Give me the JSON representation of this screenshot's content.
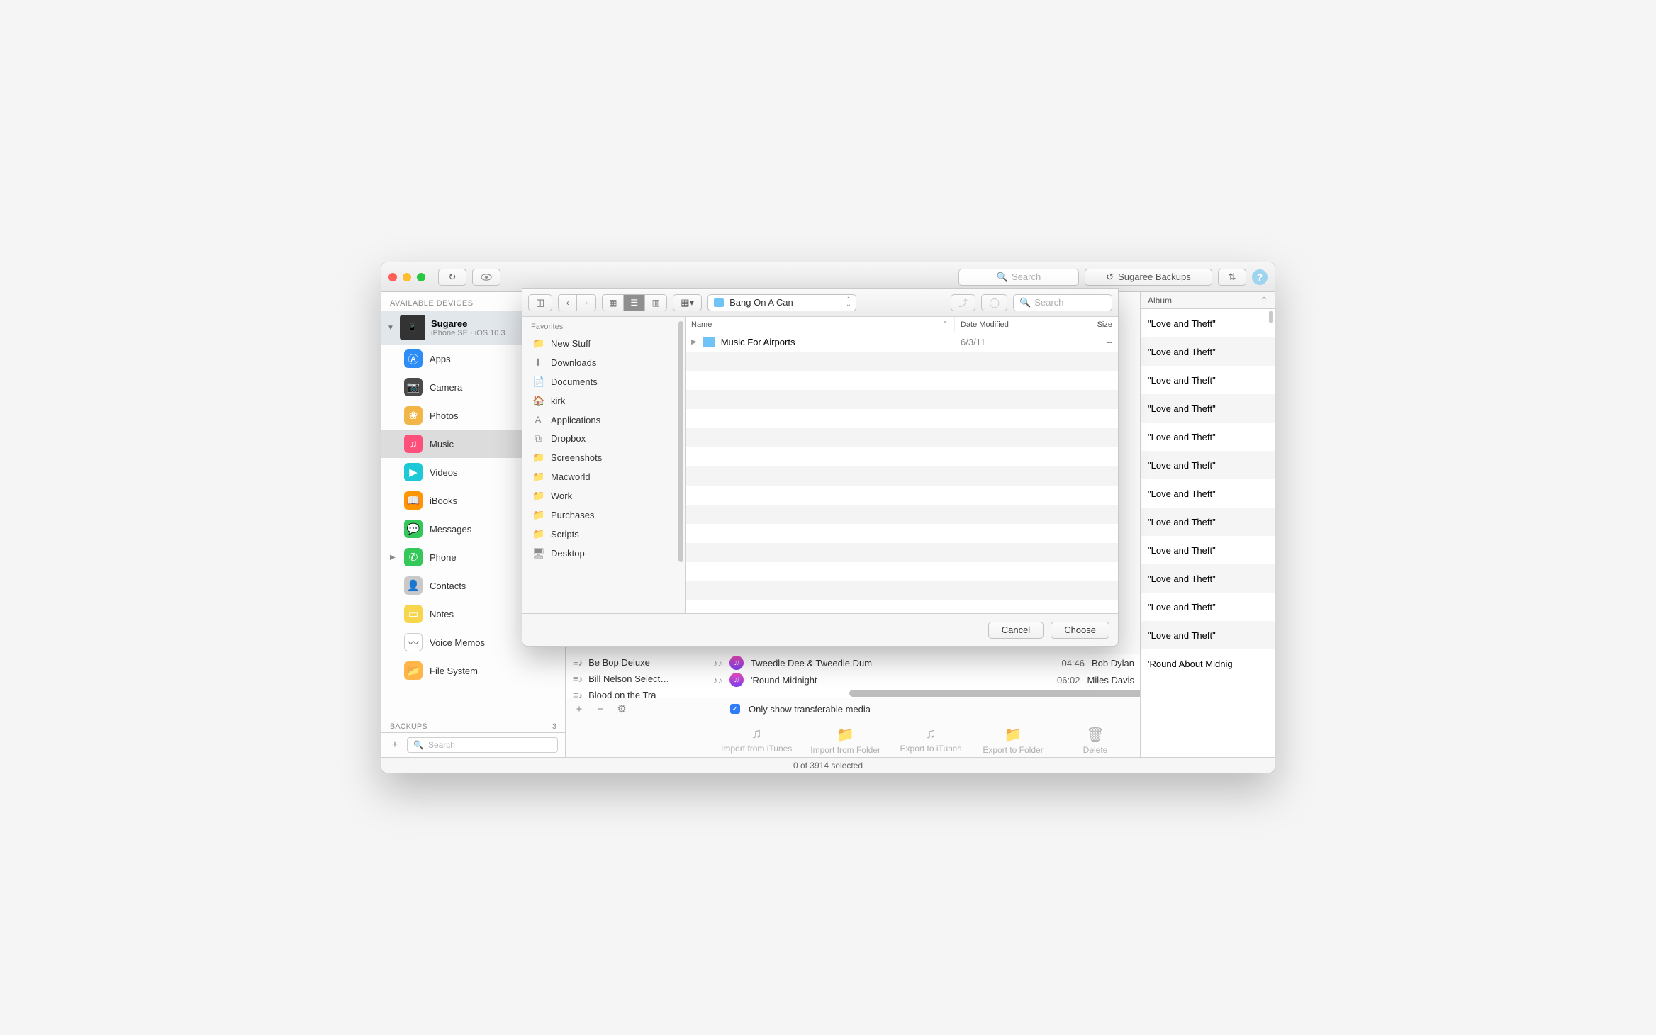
{
  "toolbar": {
    "search_placeholder": "Search",
    "backups_label": "Sugaree Backups",
    "transfers_label": "⇅"
  },
  "sidebar": {
    "available_label": "AVAILABLE DEVICES",
    "device": {
      "name": "Sugaree",
      "sub": "iPhone SE · iOS 10.3"
    },
    "items": [
      {
        "id": "apps",
        "label": "Apps",
        "color": "#2E8CF6"
      },
      {
        "id": "camera",
        "label": "Camera",
        "color": "#4A4A4A"
      },
      {
        "id": "photos",
        "label": "Photos",
        "color": "#F2B648"
      },
      {
        "id": "music",
        "label": "Music",
        "color": "#FF4F7B",
        "selected": true
      },
      {
        "id": "videos",
        "label": "Videos",
        "color": "#1FC8D6"
      },
      {
        "id": "ibooks",
        "label": "iBooks",
        "color": "#FF9500"
      },
      {
        "id": "messages",
        "label": "Messages",
        "color": "#34C759"
      },
      {
        "id": "phone",
        "label": "Phone",
        "color": "#34C759",
        "disclosure": true
      },
      {
        "id": "contacts",
        "label": "Contacts",
        "color": "#C9C9C9"
      },
      {
        "id": "notes",
        "label": "Notes",
        "color": "#F7D64E"
      },
      {
        "id": "voice",
        "label": "Voice Memos",
        "color": "#FFFFFF"
      },
      {
        "id": "fs",
        "label": "File System",
        "color": "#FFB547"
      }
    ],
    "backups_label": "BACKUPS",
    "backups_count": "3",
    "search_placeholder": "Search"
  },
  "sheet": {
    "favorites_label": "Favorites",
    "favorites": [
      {
        "label": "New Stuff",
        "icon": "📁"
      },
      {
        "label": "Downloads",
        "icon": "⬇"
      },
      {
        "label": "Documents",
        "icon": "📄"
      },
      {
        "label": "kirk",
        "icon": "🏠"
      },
      {
        "label": "Applications",
        "icon": "A"
      },
      {
        "label": "Dropbox",
        "icon": "⧉"
      },
      {
        "label": "Screenshots",
        "icon": "📁"
      },
      {
        "label": "Macworld",
        "icon": "📁"
      },
      {
        "label": "Work",
        "icon": "📁"
      },
      {
        "label": "Purchases",
        "icon": "📁"
      },
      {
        "label": "Scripts",
        "icon": "📁"
      },
      {
        "label": "Desktop",
        "icon": "🖥"
      }
    ],
    "folder_popup": "Bang On A Can",
    "columns": {
      "name": "Name",
      "date": "Date Modified",
      "size": "Size"
    },
    "rows": [
      {
        "name": "Music For Airports",
        "date": "6/3/11",
        "size": "--"
      }
    ],
    "search_placeholder": "Search",
    "cancel": "Cancel",
    "choose": "Choose"
  },
  "partial": {
    "left": [
      "Be Bop Deluxe",
      "Bill Nelson Select…",
      "Blood on the Tra"
    ],
    "right": [
      {
        "title": "Tweedle Dee & Tweedle Dum",
        "dur": "04:46",
        "artist": "Bob Dylan"
      },
      {
        "title": "'Round Midnight",
        "dur": "06:02",
        "artist": "Miles Davis"
      }
    ],
    "only_transferable": "Only show transferable media"
  },
  "actions": {
    "import_itunes": "Import from iTunes",
    "import_folder": "Import from Folder",
    "export_itunes": "Export to iTunes",
    "export_folder": "Export to Folder",
    "delete": "Delete"
  },
  "status": "0 of 3914 selected",
  "album_column": {
    "header": "Album",
    "rows": [
      "\"Love and Theft\"",
      "\"Love and Theft\"",
      "\"Love and Theft\"",
      "\"Love and Theft\"",
      "\"Love and Theft\"",
      "\"Love and Theft\"",
      "\"Love and Theft\"",
      "\"Love and Theft\"",
      "\"Love and Theft\"",
      "\"Love and Theft\"",
      "\"Love and Theft\"",
      "\"Love and Theft\"",
      "'Round About Midnig"
    ]
  }
}
